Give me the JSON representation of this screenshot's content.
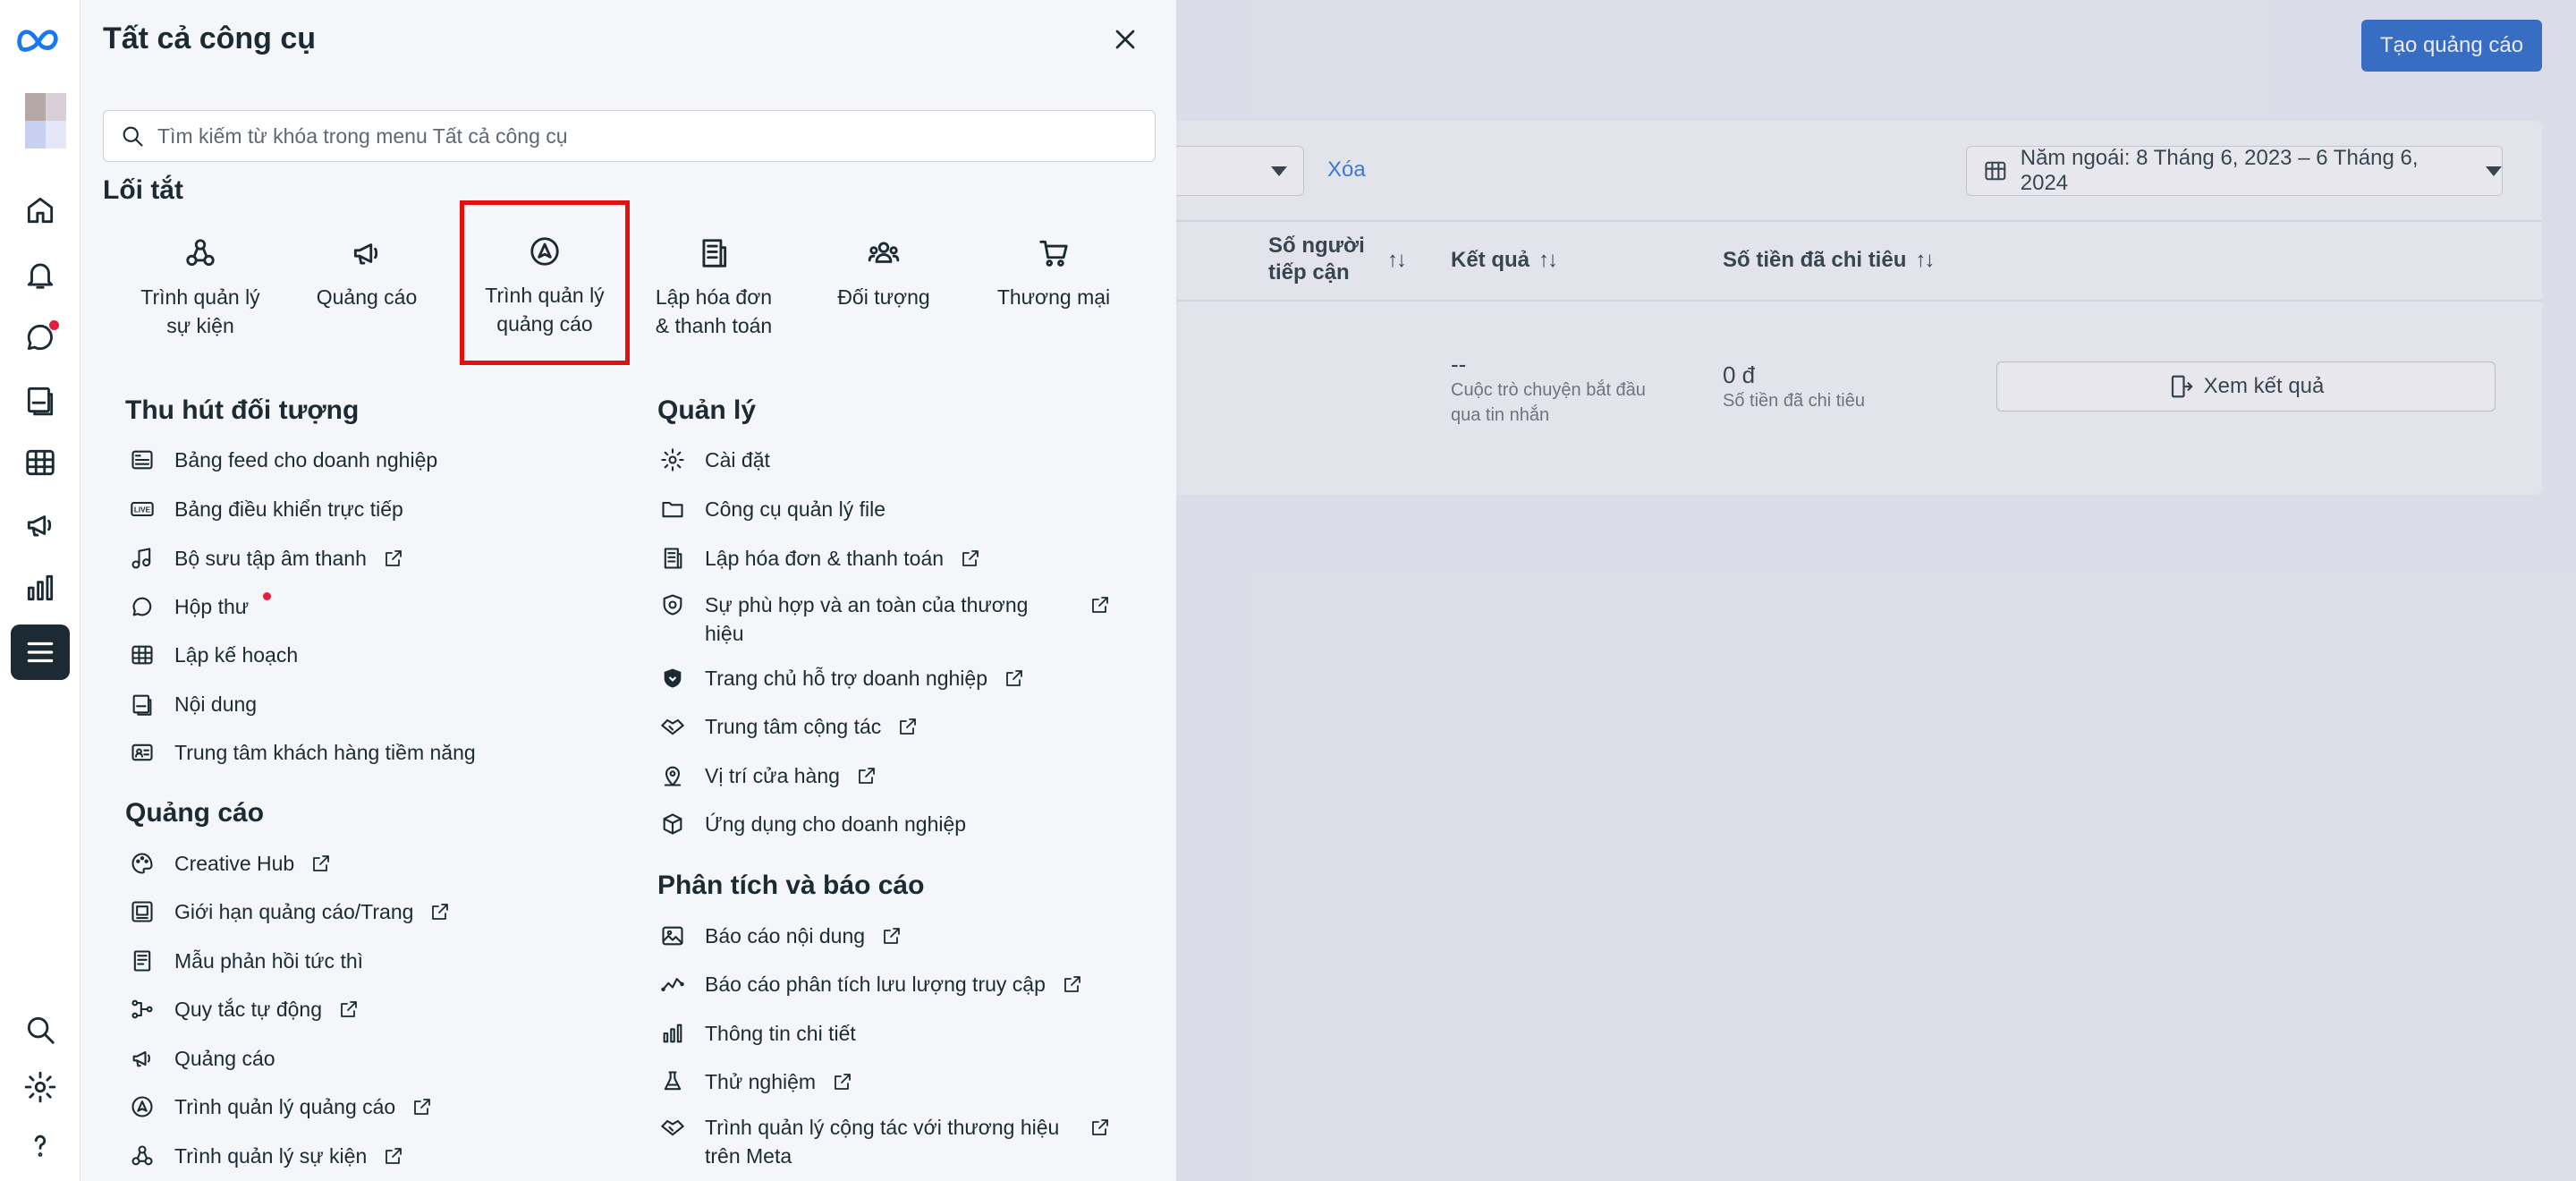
{
  "panel": {
    "title": "Tất cả công cụ",
    "search_placeholder": "Tìm kiếm từ khóa trong menu Tất cả công cụ"
  },
  "shortcuts": {
    "heading": "Lối tắt",
    "items": [
      {
        "line1": "Trình quản lý",
        "line2": "sự kiện",
        "icon": "events-manager-icon"
      },
      {
        "line1": "Quảng cáo",
        "line2": "",
        "icon": "megaphone-icon"
      },
      {
        "line1": "Trình quản lý",
        "line2": "quảng cáo",
        "icon": "ads-manager-icon"
      },
      {
        "line1": "Lập hóa đơn",
        "line2": "& thanh toán",
        "icon": "billing-icon"
      },
      {
        "line1": "Đối tượng",
        "line2": "",
        "icon": "audience-icon"
      },
      {
        "line1": "Thương mại",
        "line2": "",
        "icon": "cart-icon"
      }
    ]
  },
  "engage": {
    "title": "Thu hút đối tượng",
    "items": [
      {
        "label": "Bảng feed cho doanh nghiệp"
      },
      {
        "label": "Bảng điều khiển trực tiếp"
      },
      {
        "label": "Bộ sưu tập âm thanh"
      },
      {
        "label": "Hộp thư"
      },
      {
        "label": "Lập kế hoạch"
      },
      {
        "label": "Nội dung"
      },
      {
        "label": "Trung tâm khách hàng tiềm năng"
      }
    ]
  },
  "ads": {
    "title": "Quảng cáo",
    "items": [
      {
        "label": "Creative Hub"
      },
      {
        "label": "Giới hạn quảng cáo/Trang"
      },
      {
        "label": "Mẫu phản hồi tức thì"
      },
      {
        "label": "Quy tắc tự động"
      },
      {
        "label": "Quảng cáo"
      },
      {
        "label": "Trình quản lý quảng cáo"
      },
      {
        "label": "Trình quản lý sự kiện"
      }
    ]
  },
  "manage": {
    "title": "Quản lý",
    "items": [
      {
        "label": "Cài đặt"
      },
      {
        "label": "Công cụ quản lý file"
      },
      {
        "label": "Lập hóa đơn & thanh toán"
      },
      {
        "label": "Sự phù hợp và an toàn của thương",
        "label2": "hiệu"
      },
      {
        "label": "Trang chủ hỗ trợ doanh nghiệp"
      },
      {
        "label": "Trung tâm cộng tác"
      },
      {
        "label": "Vị trí cửa hàng"
      },
      {
        "label": "Ứng dụng cho doanh nghiệp"
      }
    ]
  },
  "analytics": {
    "title": "Phân tích và báo cáo",
    "items": [
      {
        "label": "Báo cáo nội dung"
      },
      {
        "label": "Báo cáo phân tích lưu lượng truy cập"
      },
      {
        "label": "Thông tin chi tiết"
      },
      {
        "label": "Thử nghiệm"
      },
      {
        "label": "Trình quản lý cộng tác với thương hiệu",
        "label2": "trên Meta"
      }
    ]
  },
  "background": {
    "create_button": "Tạo quảng cáo",
    "clear_link": "Xóa",
    "date_range": "Năm ngoái: 8 Tháng 6, 2023 – 6 Tháng 6, 2024",
    "col_reach_line1": "Số người",
    "col_reach_line2": "tiếp cận",
    "col_results": "Kết quả",
    "col_spent": "Số tiền đã chi tiêu",
    "sort_glyph": "↑↓",
    "result_value": "--",
    "result_sub_line1": "Cuộc trò chuyện bắt đầu",
    "result_sub_line2": "qua tin nhắn",
    "spent_value": "0 đ",
    "spent_sub": "Số tiền đã chi tiêu",
    "view_results": "Xem kết quả"
  },
  "colors": {
    "accent": "#1b5fc7",
    "highlight": "#e60f0f",
    "notification": "#e41e3f"
  }
}
